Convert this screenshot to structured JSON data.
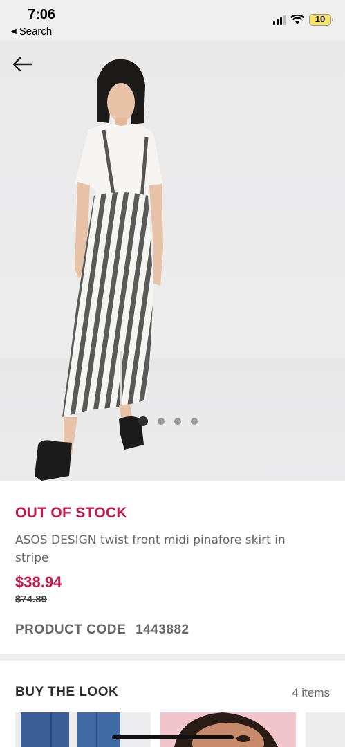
{
  "status_bar": {
    "time": "7:06",
    "back_app": "Search",
    "battery": "10"
  },
  "hero": {
    "back_icon": "arrow-left-icon",
    "image_count": 4,
    "active_image": 1
  },
  "product": {
    "stock_status": "OUT OF STOCK",
    "title": "ASOS DESIGN twist front midi pinafore skirt in stripe",
    "price": "$38.94",
    "old_price": "$74.89",
    "code_label": "PRODUCT CODE",
    "code_value": "1443882"
  },
  "buy_the_look": {
    "title": "BUY THE LOOK",
    "count": "4 items"
  },
  "colors": {
    "accent": "#c9174a",
    "text_dark": "#2d2d2d",
    "text_muted": "#666666"
  }
}
